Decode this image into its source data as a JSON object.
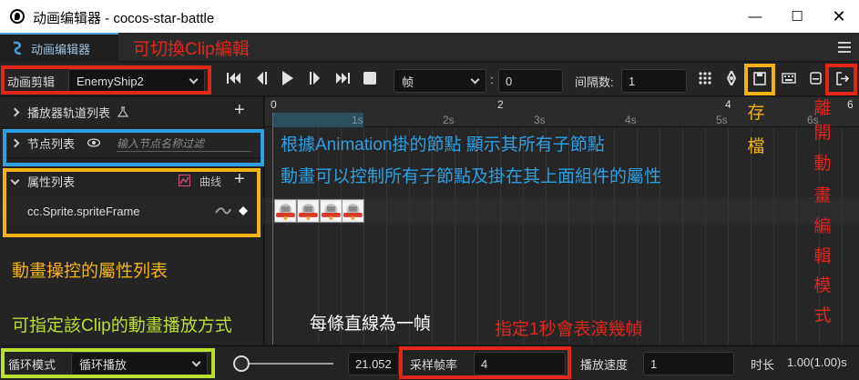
{
  "colors": {
    "accent": "#4b9fd6",
    "red_note": "#e0261d",
    "blue_note": "#2f9fe0",
    "yellow_note": "#f2b318",
    "green_note": "#b8e030",
    "white_note": "#ffffff",
    "playhead": "#d23c50"
  },
  "window": {
    "title": "动画编辑器 - cocos-star-battle",
    "minimize_icon": "minimize-icon",
    "maximize_icon": "maximize-icon",
    "close_icon": "close-icon",
    "close_glyph": "✕",
    "maximize_glyph": "☐",
    "minimize_glyph": "—"
  },
  "tabs": [
    {
      "label": "动画编辑器",
      "icon": "animation-icon"
    }
  ],
  "toolbar": {
    "clip_label": "动画剪辑",
    "clip_value": "EnemyShip2",
    "unit_value": "帧",
    "colon": ":",
    "frame_value": "0",
    "interval_label": "间隔数:",
    "interval_value": "1",
    "buttons": [
      "jump-first-icon",
      "prev-frame-icon",
      "play-icon",
      "next-frame-icon",
      "jump-last-icon",
      "stop-icon"
    ],
    "right_icons": [
      "grid-icon",
      "move-icon",
      "save-icon",
      "keyboard-icon",
      "collapse-icon",
      "exit-icon"
    ]
  },
  "left_panel": {
    "player_tracks": "播放器轨道列表",
    "node_list": "节点列表",
    "node_search_placeholder": "输入节点名称过滤",
    "property_list": "属性列表",
    "curve_label": "曲线",
    "property_item": "cc.Sprite.spriteFrame"
  },
  "ruler": {
    "ticks": [
      "1s",
      "2s",
      "3s",
      "4s",
      "5s",
      "6s"
    ],
    "markers": [
      "0",
      "2",
      "4",
      "6"
    ]
  },
  "bottom": {
    "wrap_label": "循环模式",
    "wrap_value": "循环播放",
    "slider_value": "21.052",
    "sample_label": "采样帧率",
    "sample_value": "4",
    "speed_label": "播放速度",
    "speed_value": "1",
    "duration_label": "时长",
    "duration_value": "1.00(1.00)s"
  },
  "annotations": {
    "switch_clip": "可切換Clip編輯",
    "show_nodes": "根據Animation掛的節點 顯示其所有子節點",
    "control_props": "動畫可以控制所有子節點及掛在其上面組件的屬性",
    "prop_list": "動畫操控的屬性列表",
    "play_mode": "可指定該Clip的動畫播放方式",
    "frame_line": "每條直線為一幀",
    "sample_rate": "指定1秒會表演幾幀",
    "save_chars": [
      "存",
      "檔"
    ],
    "exit_chars": [
      "離",
      "開",
      "動",
      "畫",
      "編",
      "輯",
      "模",
      "式"
    ]
  }
}
